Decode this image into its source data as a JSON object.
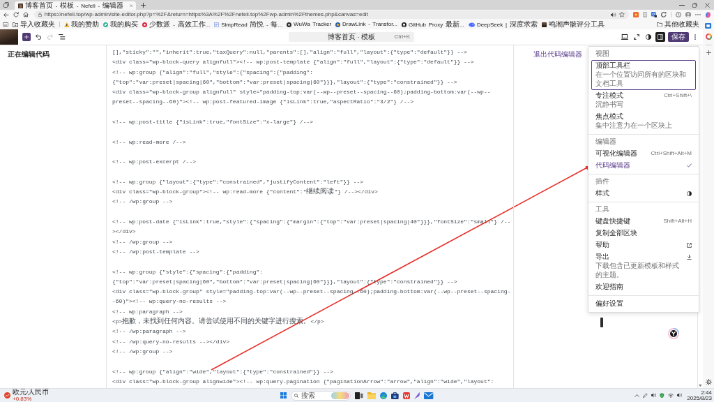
{
  "browser": {
    "tab": {
      "title": "博客首页 - 模板 - Nefeli - 编辑器"
    },
    "address": "https://nefeli.top/wp-admin/site-editor.php?p=%2F&return=https%3A%2F%2Fnefeli.top%2Fwp-admin%2Fthemes.php&canvas=edit",
    "bookmarks": [
      {
        "label": "导入收藏夹",
        "kind": "import"
      },
      {
        "label": "我的赞助",
        "kind": "triangle"
      },
      {
        "label": "我的购买",
        "kind": "leaf"
      },
      {
        "label": "少数派 - 高效工作...",
        "kind": "dot"
      },
      {
        "label": "SimpRead 简悦 - 每...",
        "kind": "page"
      },
      {
        "label": "WuWa Tracker",
        "kind": "disc"
      },
      {
        "label": "DrawLink - Transfor...",
        "kind": "globe"
      },
      {
        "label": "GitHub Proxy 最新...",
        "kind": "cat"
      },
      {
        "label": "DeepSeek | 深度求索",
        "kind": "whale"
      },
      {
        "label": "鸣潮声骸评分工具",
        "kind": "photo"
      }
    ],
    "other_bookmarks": "其他收藏夹"
  },
  "editor": {
    "header": {
      "left_tools": [
        {
          "kind": "undo",
          "disabled": false
        },
        {
          "kind": "redo",
          "disabled": true
        },
        {
          "kind": "list",
          "disabled": false
        }
      ],
      "command_bar": {
        "title": "博客首页 · 模板",
        "shortcut": "Ctrl+K"
      },
      "right_tools": [
        {
          "kind": "device",
          "pressed": false
        },
        {
          "kind": "expand",
          "pressed": false
        },
        {
          "kind": "contrast",
          "pressed": false
        },
        {
          "kind": "sidebar",
          "pressed": true
        }
      ],
      "save": "保存"
    },
    "mode_label": "正在编辑代码",
    "exit_link": "退出代码编辑器",
    "code_blocks": [
      [
        "[],\"sticky\":\"\",\"inherit\":true,\"taxQuery\":null,\"parents\":[],\"align\":\"full\",\"layout\":{\"type\":\"default\"}} -->",
        "<div class=\"wp-block-query alignfull\"><!-- wp:post-template {\"align\":\"full\",\"layout\":{\"type\":\"default\"}} -->",
        "<!-- wp:group {\"align\":\"full\",\"style\":{\"spacing\":{\"padding\":",
        "{\"top\":\"var:preset|spacing|60\",\"bottom\":\"var:preset|spacing|60\"}}},\"layout\":{\"type\":\"constrained\"}} -->",
        "<div class=\"wp-block-group alignfull\" style=\"padding-top:var(--wp--preset--spacing--60);padding-bottom:var(--wp--",
        "preset--spacing--60)\"><!-- wp:post-featured-image {\"isLink\":true,\"aspectRatio\":\"3/2\"} /-->"
      ],
      [
        "<!-- wp:post-title {\"isLink\":true,\"fontSize\":\"x-large\"} /-->"
      ],
      [
        "<!-- wp:read-more /-->"
      ],
      [
        "<!-- wp:post-excerpt /-->"
      ],
      [
        "<!-- wp:group {\"layout\":{\"type\":\"constrained\",\"justifyContent\":\"left\"}} -->",
        "<div class=\"wp-block-group\"><!-- wp:read-more {\"content\":\"继续阅读\"} /--></div>",
        "<!-- /wp:group -->"
      ],
      [
        "<!-- wp:post-date {\"isLink\":true,\"style\":{\"spacing\":{\"margin\":{\"top\":\"var:preset|spacing|40\"}}},\"fontSize\":\"small\"} /--",
        "></div>",
        "<!-- /wp:group -->",
        "<!-- /wp:post-template -->"
      ],
      [
        "<!-- wp:group {\"style\":{\"spacing\":{\"padding\":",
        "{\"top\":\"var:preset|spacing|60\",\"bottom\":\"var:preset|spacing|60\"}}},\"layout\":{\"type\":\"constrained\"}} -->",
        "<div class=\"wp-block-group\" style=\"padding-top:var(--wp--preset--spacing--60);padding-bottom:var(--wp--preset--spacing-",
        "-60)\"><!-- wp:query-no-results -->",
        "<!-- wp:paragraph -->",
        "<p>抱歉，未找到任何内容。请尝试使用不同的关键字进行搜索。</p>",
        "<!-- /wp:paragraph -->",
        "<!-- /wp:query-no-results --></div>",
        "<!-- /wp:group -->"
      ],
      [
        "<!-- wp:group {\"align\":\"wide\",\"layout\":{\"type\":\"constrained\"}} -->",
        "<div class=\"wp-block-group alignwide\"><!-- wp:query-pagination {\"paginationArrow\":\"arrow\",\"align\":\"wide\",\"layout\":"
      ]
    ]
  },
  "menu": {
    "sections": [
      {
        "heading": "视图",
        "items": [
          {
            "label": "顶部工具栏",
            "subtitle": "在一个位置访问所有的区块和文档工具",
            "focused": true
          },
          {
            "label": "专注模式",
            "subtitle": "沉静书写",
            "shortcut": "Ctrl+Shift+\\",
            "focused": false
          },
          {
            "label": "焦点模式",
            "subtitle": "集中注意力在一个区块上",
            "focused": false
          }
        ]
      },
      {
        "heading": "编辑器",
        "items": [
          {
            "label": "可视化编辑器",
            "shortcut": "Ctrl+Shift+Alt+M",
            "selected": false
          },
          {
            "label": "代码编辑器",
            "selected": true
          }
        ]
      },
      {
        "heading": "插件",
        "items": [
          {
            "label": "样式",
            "kind": "contrast"
          }
        ]
      },
      {
        "heading": "工具",
        "items": [
          {
            "label": "键盘快捷键",
            "shortcut": "Shift+Alt+H",
            "kind": "plain"
          },
          {
            "label": "复制全部区块",
            "kind": "plain"
          },
          {
            "label": "帮助",
            "kind": "external"
          },
          {
            "label": "导出",
            "subtitle": "下载包含已更新模板和样式的主题。",
            "kind": "download"
          },
          {
            "label": "欢迎指南",
            "kind": "plain"
          }
        ]
      },
      {
        "items": [
          {
            "label": "偏好设置"
          }
        ]
      }
    ]
  },
  "taskbar": {
    "widget": {
      "title": "欧元/人民币",
      "change": "+0.83%"
    },
    "search": {
      "placeholder": "搜索"
    },
    "time": "2:44",
    "date": "2025/8/23"
  }
}
